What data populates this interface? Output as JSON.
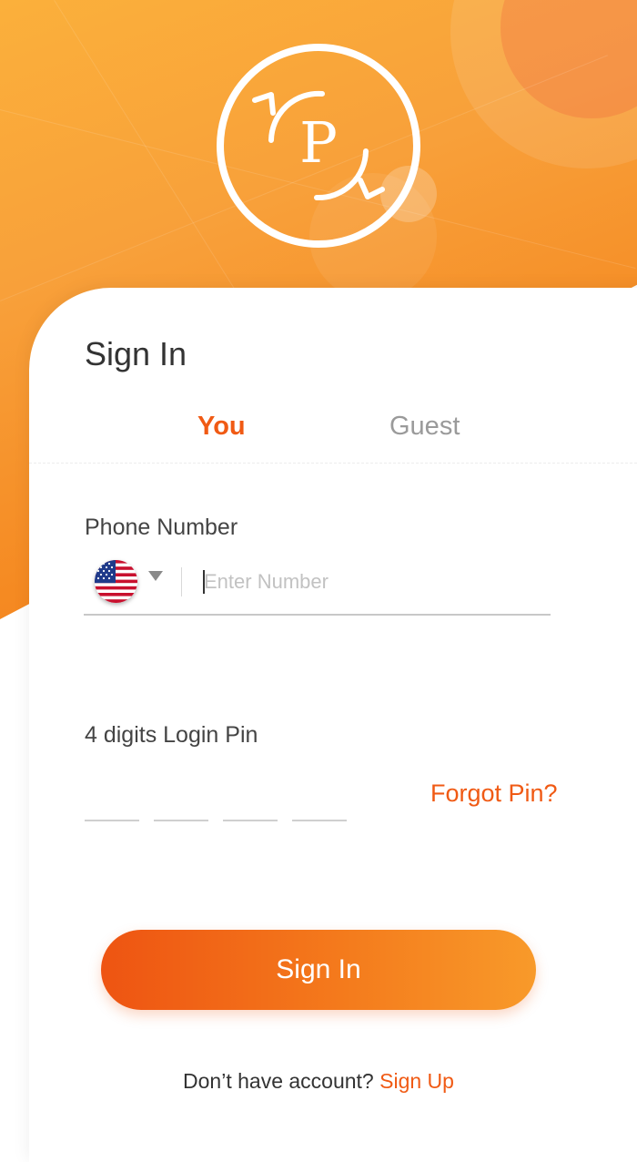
{
  "brand": {
    "logo_letter": "P",
    "accent_color": "#f05a14",
    "gradient_start": "#fbb03b",
    "gradient_end": "#f07a1a"
  },
  "form": {
    "title": "Sign In",
    "tabs": [
      {
        "label": "You",
        "active": true
      },
      {
        "label": "Guest",
        "active": false
      }
    ],
    "phone": {
      "label": "Phone Number",
      "country_flag": "us-flag-icon",
      "placeholder": "Enter Number",
      "value": ""
    },
    "pin": {
      "label": "4 digits Login Pin",
      "digits": [
        "",
        "",
        "",
        ""
      ],
      "forgot_label": "Forgot Pin?"
    },
    "submit_label": "Sign In"
  },
  "footer": {
    "prompt": "Don’t have account? ",
    "signup_label": "Sign Up"
  }
}
